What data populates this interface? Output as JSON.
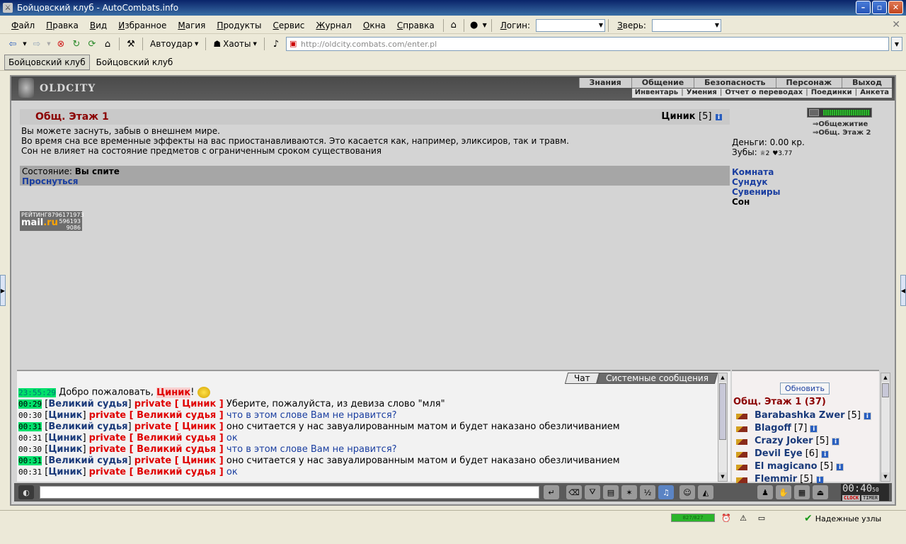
{
  "window": {
    "title": "Бойцовский клуб - AutoCombats.info",
    "controls": [
      "–",
      "▫",
      "✕"
    ]
  },
  "menu": {
    "items": [
      "Файл",
      "Правка",
      "Вид",
      "Избранное",
      "Магия",
      "Продукты",
      "Сервис",
      "Журнал",
      "Окна",
      "Справка"
    ],
    "login_label": "Логин:",
    "beast_label": "Зверь:"
  },
  "toolbar": {
    "autostrike": "Автоудар",
    "chaos": "Хаоты",
    "url": "http://oldcity.combats.com/enter.pl"
  },
  "tabs": [
    "Бойцовский клуб",
    "Бойцовский клуб"
  ],
  "game": {
    "logo": "OLDCITY",
    "nav_top": [
      "Знания",
      "Общение",
      "Безопасность",
      "Персонаж",
      "Выход"
    ],
    "nav_bottom": [
      "Инвентарь",
      "Умения",
      "Отчет о переводах",
      "Поединки",
      "Анкета"
    ],
    "room_title": "Общ. Этаж 1",
    "player_name": "Циник",
    "player_level": "[5]",
    "desc_lines": [
      "Вы можете заснуть, забыв о внешнем мире.",
      "Во время сна все временные эффекты на вас приостанавливаются. Это касается как, например, эликсиров, так и травм.",
      "Сон не влияет на состояние предметов с ограниченным сроком существования"
    ],
    "state_label": "Состояние:",
    "state_value": "Вы спите",
    "wake_link": "Проснуться",
    "counter": {
      "label": "РЕЙТИНГ",
      "id": "8796171973",
      "brand_main": "mail",
      "brand_tld": ".ru",
      "n1": "596193",
      "n2": "9086"
    },
    "locations": [
      "Общежитие",
      "Общ. Этаж 2"
    ],
    "money": "Деньги: 0.00 кр.",
    "teeth_label": "Зубы:",
    "teeth_a": "2",
    "teeth_b": "3.77",
    "links": [
      "Комната",
      "Сундук",
      "Сувениры",
      "Сон"
    ]
  },
  "chat": {
    "tabs": [
      "Чат",
      "Системные сообщения"
    ],
    "welcome_time": "23:55:29",
    "welcome_text": "Добро пожаловать,",
    "welcome_name": "Циник",
    "lines": [
      {
        "time": "00:29",
        "hl": true,
        "from": "Великий судья",
        "to": "Циник",
        "text": "Уберите, пожалуйста, из девиза слово \"мля\"",
        "blue": false
      },
      {
        "time": "00:30",
        "hl": false,
        "from": "Циник",
        "to": "Великий судья",
        "text": "что в этом слове Вам не нравится?",
        "blue": true
      },
      {
        "time": "00:31",
        "hl": true,
        "from": "Великий судья",
        "to": "Циник",
        "text": "оно считается у нас завуалированным матом и будет наказано обезличиванием",
        "blue": false
      },
      {
        "time": "00:31",
        "hl": false,
        "from": "Циник",
        "to": "Великий судья",
        "text": "ок",
        "blue": true
      },
      {
        "time": "00:30",
        "hl": false,
        "from": "Циник",
        "to": "Великий судья",
        "text": "что в этом слове Вам не нравится?",
        "blue": true
      },
      {
        "time": "00:31",
        "hl": true,
        "from": "Великий судья",
        "to": "Циник",
        "text": "оно считается у нас завуалированным матом и будет наказано обезличиванием",
        "blue": false
      },
      {
        "time": "00:31",
        "hl": false,
        "from": "Циник",
        "to": "Великий судья",
        "text": "ок",
        "blue": true
      }
    ],
    "private_word": "private"
  },
  "users": {
    "refresh": "Обновить",
    "title": "Общ. Этаж 1 (37)",
    "list": [
      {
        "name": "Barabashka Zwer",
        "level": "[5]"
      },
      {
        "name": "Blagoff",
        "level": "[7]"
      },
      {
        "name": "Crazy Joker",
        "level": "[5]"
      },
      {
        "name": "Devil Eye",
        "level": "[6]"
      },
      {
        "name": "El magicano",
        "level": "[5]"
      },
      {
        "name": "Flemmir",
        "level": "[5]"
      }
    ]
  },
  "clock": {
    "time": "00:40",
    "seconds": "50",
    "clock_label": "CLOCK",
    "timer_label": "TIMER"
  },
  "status": {
    "progress": "827/827",
    "secure": "Надежные узлы"
  }
}
